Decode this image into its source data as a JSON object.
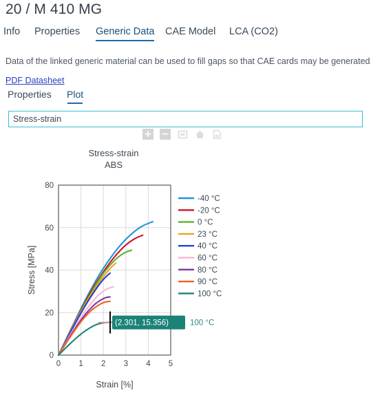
{
  "header": {
    "title": "20 / M 410 MG"
  },
  "main_tabs": [
    {
      "label": "Info",
      "active": false
    },
    {
      "label": "Properties",
      "active": false
    },
    {
      "label": "Generic Data",
      "active": true
    },
    {
      "label": "CAE Model",
      "active": false
    },
    {
      "label": "LCA (CO2)",
      "active": false
    }
  ],
  "description": "Data of the linked generic material can be used to fill gaps so that CAE cards may be generated.",
  "pdf_link": {
    "label": "PDF Datasheet"
  },
  "sub_tabs": [
    {
      "label": "Properties",
      "active": false
    },
    {
      "label": "Plot",
      "active": true
    }
  ],
  "plot_select": {
    "value": "Stress-strain",
    "placeholder": "Stress-strain"
  },
  "plot_toolbar": [
    {
      "icon": "zoom-in-icon",
      "glyph": "+"
    },
    {
      "icon": "zoom-out-icon",
      "glyph": "−"
    },
    {
      "icon": "fit-to-screen-icon",
      "glyph": ""
    },
    {
      "icon": "home-icon",
      "glyph": ""
    },
    {
      "icon": "save-image-icon",
      "glyph": ""
    }
  ],
  "chart_data": {
    "type": "line",
    "title": "Stress-strain",
    "subtitle": "ABS",
    "xlabel": "Strain [%]",
    "ylabel": "Stress [MPa]",
    "xlim": [
      0,
      5
    ],
    "ylim": [
      0,
      80
    ],
    "xticks": [
      0,
      1,
      2,
      3,
      4,
      5
    ],
    "yticks": [
      0,
      20,
      40,
      60,
      80
    ],
    "grid": true,
    "legend_position": "right",
    "series": [
      {
        "name": "-40 °C",
        "color": "#2196d6",
        "x": [
          0,
          0.25,
          0.5,
          0.8,
          1.1,
          1.4,
          1.8,
          2.2,
          2.7,
          3.2,
          3.7,
          4.2
        ],
        "y": [
          0,
          5.5,
          11.0,
          17.5,
          24.0,
          30.0,
          37.5,
          44.0,
          51.0,
          56.5,
          60.5,
          62.8
        ]
      },
      {
        "name": "-20 °C",
        "color": "#d11030",
        "x": [
          0,
          0.25,
          0.5,
          0.8,
          1.1,
          1.4,
          1.8,
          2.2,
          2.6,
          3.0,
          3.4,
          3.75
        ],
        "y": [
          0,
          5.4,
          10.8,
          17.0,
          23.2,
          29.0,
          36.0,
          42.2,
          47.5,
          51.8,
          54.8,
          56.4
        ]
      },
      {
        "name": "0 °C",
        "color": "#5cb327",
        "x": [
          0,
          0.25,
          0.5,
          0.8,
          1.1,
          1.4,
          1.75,
          2.1,
          2.5,
          2.9,
          3.25
        ],
        "y": [
          0,
          5.3,
          10.6,
          16.7,
          22.7,
          28.2,
          34.5,
          39.8,
          44.6,
          47.9,
          49.4
        ]
      },
      {
        "name": "23 °C",
        "color": "#f0a020",
        "x": [
          0,
          0.25,
          0.5,
          0.8,
          1.1,
          1.4,
          1.75,
          2.1,
          2.35,
          2.55
        ],
        "y": [
          0,
          5.2,
          10.4,
          16.4,
          22.2,
          27.6,
          33.4,
          38.2,
          41.3,
          43.3
        ]
      },
      {
        "name": "40 °C",
        "color": "#2440d8",
        "x": [
          0,
          0.25,
          0.5,
          0.8,
          1.1,
          1.4,
          1.7,
          1.95,
          2.15,
          2.3
        ],
        "y": [
          0,
          5.1,
          10.2,
          16.0,
          21.6,
          26.8,
          31.5,
          35.0,
          37.2,
          38.6
        ]
      },
      {
        "name": "60 °C",
        "color": "#f8b7d6",
        "x": [
          0,
          0.25,
          0.5,
          0.8,
          1.1,
          1.4,
          1.7,
          1.95,
          2.2,
          2.45
        ],
        "y": [
          0,
          4.6,
          9.2,
          14.4,
          19.4,
          23.6,
          27.4,
          29.7,
          31.3,
          32.2
        ]
      },
      {
        "name": "80 °C",
        "color": "#7a38a8",
        "x": [
          0,
          0.25,
          0.5,
          0.8,
          1.1,
          1.4,
          1.65,
          1.9,
          2.1,
          2.3
        ],
        "y": [
          0,
          4.3,
          8.6,
          13.4,
          17.9,
          21.6,
          24.2,
          26.0,
          27.0,
          27.4
        ]
      },
      {
        "name": "90 °C",
        "color": "#f4601f",
        "x": [
          0,
          0.25,
          0.5,
          0.8,
          1.1,
          1.4,
          1.65,
          1.9,
          2.1,
          2.3
        ],
        "y": [
          0,
          4.1,
          8.2,
          12.8,
          17.0,
          20.4,
          22.6,
          24.2,
          25.0,
          25.3
        ]
      },
      {
        "name": "100 °C",
        "color": "#1a8277",
        "x": [
          0,
          0.25,
          0.5,
          0.8,
          1.1,
          1.4,
          1.7,
          2.0,
          2.3,
          2.55
        ],
        "y": [
          0,
          2.6,
          5.2,
          8.1,
          10.7,
          12.8,
          14.4,
          15.2,
          15.4,
          15.4
        ]
      }
    ],
    "hover": {
      "point": [
        2.301,
        15.356
      ],
      "tooltip_text": "(2.301, 15.356)",
      "series_label": "100 °C",
      "series_color": "#1a8277"
    }
  }
}
